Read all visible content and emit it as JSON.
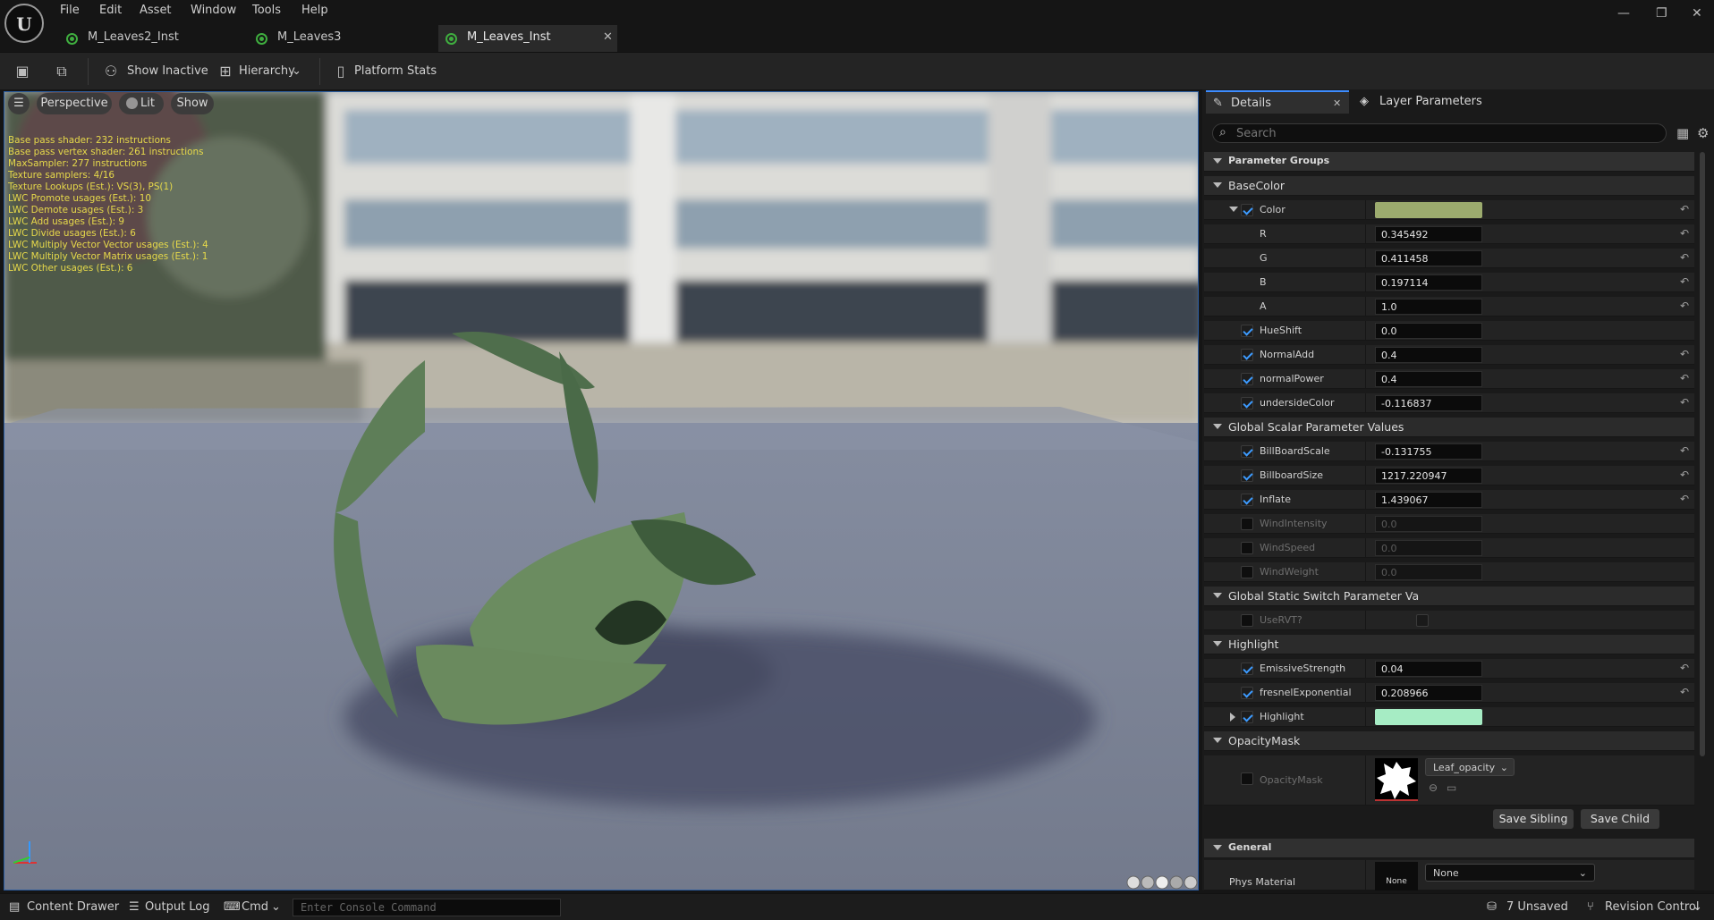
{
  "menu": {
    "file": "File",
    "edit": "Edit",
    "asset": "Asset",
    "window": "Window",
    "tools": "Tools",
    "help": "Help"
  },
  "tabs": [
    {
      "label": "M_Leaves2_Inst"
    },
    {
      "label": "M_Leaves3"
    },
    {
      "label": "M_Leaves_Inst"
    }
  ],
  "toolbar": {
    "show_inactive": "Show Inactive",
    "hierarchy": "Hierarchy",
    "platform_stats": "Platform Stats"
  },
  "viewport": {
    "perspective": "Perspective",
    "lit": "Lit",
    "show": "Show",
    "stats": [
      "Base pass shader: 232 instructions",
      "Base pass vertex shader: 261 instructions",
      "MaxSampler: 277 instructions",
      "Texture samplers: 4/16",
      "Texture Lookups (Est.): VS(3), PS(1)",
      "LWC Promote usages (Est.): 10",
      "LWC Demote usages (Est.): 3",
      "LWC Add usages (Est.): 9",
      "LWC Divide usages (Est.): 6",
      "LWC Multiply Vector Vector usages (Est.): 4",
      "LWC Multiply Vector Matrix usages (Est.): 1",
      "LWC Other usages (Est.): 6"
    ]
  },
  "details": {
    "tab_details": "Details",
    "tab_layers": "Layer Parameters",
    "search_placeholder": "Search",
    "parameter_groups": "Parameter Groups",
    "basecolor": {
      "title": "BaseColor",
      "color_label": "Color",
      "color_value": "#9cab6e",
      "r_label": "R",
      "r": "0.345492",
      "g_label": "G",
      "g": "0.411458",
      "b_label": "B",
      "b": "0.197114",
      "a_label": "A",
      "a": "1.0",
      "hueshift_label": "HueShift",
      "hueshift": "0.0",
      "normaladd_label": "NormalAdd",
      "normaladd": "0.4",
      "normalpower_label": "normalPower",
      "normalpower": "0.4",
      "underside_label": "undersideColor",
      "underside": "-0.116837"
    },
    "global_scalar": {
      "title": "Global Scalar Parameter Values",
      "billboardscale_label": "BillBoardScale",
      "billboardscale": "-0.131755",
      "billboardsize_label": "BillboardSize",
      "billboardsize": "1217.220947",
      "inflate_label": "Inflate",
      "inflate": "1.439067",
      "windintensity_label": "WindIntensity",
      "windintensity": "0.0",
      "windspeed_label": "WindSpeed",
      "windspeed": "0.0",
      "windweight_label": "WindWeight",
      "windweight": "0.0"
    },
    "global_static": {
      "title": "Global Static Switch Parameter Va",
      "uservt_label": "UseRVT?"
    },
    "highlight": {
      "title": "Highlight",
      "emissive_label": "EmissiveStrength",
      "emissive": "0.04",
      "fresnel_label": "fresnelExponential",
      "fresnel": "0.208966",
      "highlight_label": "Highlight",
      "highlight_color": "#a6ecc4"
    },
    "opacity": {
      "title": "OpacityMask",
      "mask_label": "OpacityMask",
      "texture": "Leaf_opacity"
    },
    "save_sibling": "Save Sibling",
    "save_child": "Save Child",
    "general": {
      "title": "General",
      "phys_label": "Phys Material",
      "none_thumb": "None",
      "phys_value": "None"
    }
  },
  "status": {
    "content_drawer": "Content Drawer",
    "output_log": "Output Log",
    "cmd": "Cmd",
    "console_placeholder": "Enter Console Command",
    "unsaved": "7 Unsaved",
    "revision": "Revision Control"
  },
  "colors": {
    "accent": "#3d8cff",
    "stats_text": "#e6d94a",
    "tab_icon": "#3fae3f"
  }
}
